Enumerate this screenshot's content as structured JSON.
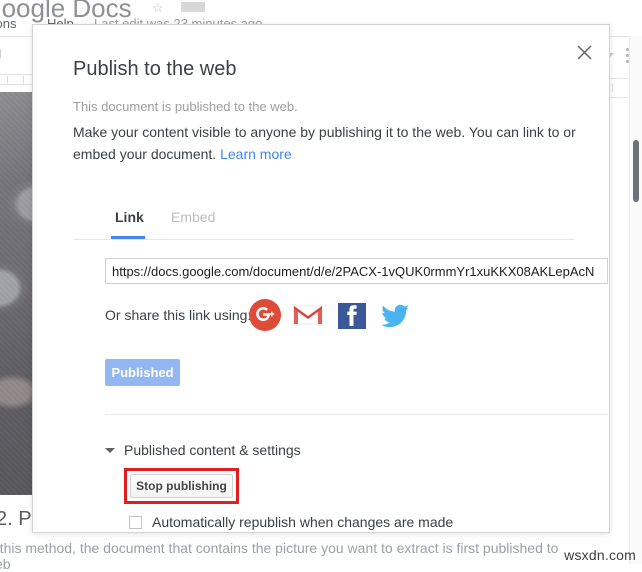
{
  "background": {
    "doc_title": "om Google Docs",
    "menu_addons": "d-ons",
    "menu_help": "Help",
    "last_edit": "Last edit was 23 minutes ago",
    "toolbar_style": "al",
    "ruler_marks": "|   |   |",
    "heading_2": "2. P",
    "paragraph_line1": "n this method, the document that contains the picture you want to extract is first published to",
    "paragraph_line2": "veb",
    "right_box_text": "|  |  |",
    "watermark": "wsxdn.com"
  },
  "dialog": {
    "title": "Publish to the web",
    "status_text": "This document is published to the web.",
    "description": "Make your content visible to anyone by publishing it to the web. You can link to or embed your document.",
    "learn_more": "Learn more",
    "close_icon": "close-icon",
    "tabs": [
      {
        "id": "link",
        "label": "Link",
        "active": true
      },
      {
        "id": "embed",
        "label": "Embed",
        "active": false
      }
    ],
    "url_value": "https://docs.google.com/document/d/e/2PACX-1vQUK0rmmYr1xuKKX08AKLepAcN",
    "share_label": "Or share this link using:",
    "social_icons": [
      {
        "id": "gplus",
        "name": "google-plus-icon",
        "label": "G+",
        "color": "#dd4b39"
      },
      {
        "id": "gmail",
        "name": "gmail-icon",
        "label": "M",
        "color": "#db4437"
      },
      {
        "id": "facebook",
        "name": "facebook-icon",
        "label": "f",
        "color": "#3b5998"
      },
      {
        "id": "twitter",
        "name": "twitter-icon",
        "label": "bird",
        "color": "#4ab3f4"
      }
    ],
    "published_button": "Published",
    "published_button_color": "#93b7f3",
    "settings_section_label": "Published content & settings",
    "stop_publishing_button": "Stop publishing",
    "highlight_color": "#e02020",
    "auto_republish_label": "Automatically republish when changes are made",
    "auto_republish_checked": false
  }
}
